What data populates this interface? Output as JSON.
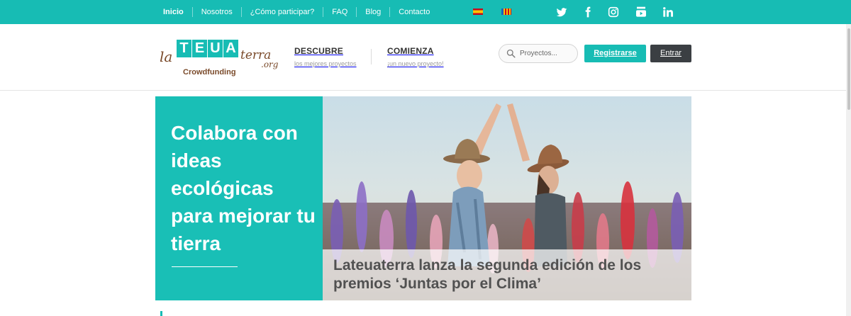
{
  "topbar": {
    "nav": [
      "Inicio",
      "Nosotros",
      "¿Cómo participar?",
      "FAQ",
      "Blog",
      "Contacto"
    ],
    "active": "Inicio",
    "languages": [
      "es-flag-icon",
      "valencia-flag-icon"
    ],
    "social": [
      "twitter-icon",
      "facebook-icon",
      "instagram-icon",
      "youtube-icon",
      "linkedin-icon"
    ],
    "color": "#17bcb4"
  },
  "logo": {
    "prefix": "la",
    "tiles": [
      "T",
      "E",
      "U",
      "A"
    ],
    "suffix": "terra",
    "domain": ".org",
    "tagline": "Crowdfunding"
  },
  "menu": {
    "discover": {
      "title": "DESCUBRE",
      "subtitle": "los mejores proyectos"
    },
    "start": {
      "title": "COMIENZA",
      "subtitle": "¡un nuevo proyecto!"
    }
  },
  "search": {
    "placeholder": "Proyectos...",
    "icon": "search-icon"
  },
  "buttons": {
    "register": "Registrarse",
    "login": "Entrar"
  },
  "hero": {
    "headline": "Colabora con ideas ecológicas para mejorar tu tierra",
    "caption": "Lateuaterra lanza la segunda edición de los premios ‘Juntas por el Clima’",
    "accent": "#19bfb6"
  }
}
